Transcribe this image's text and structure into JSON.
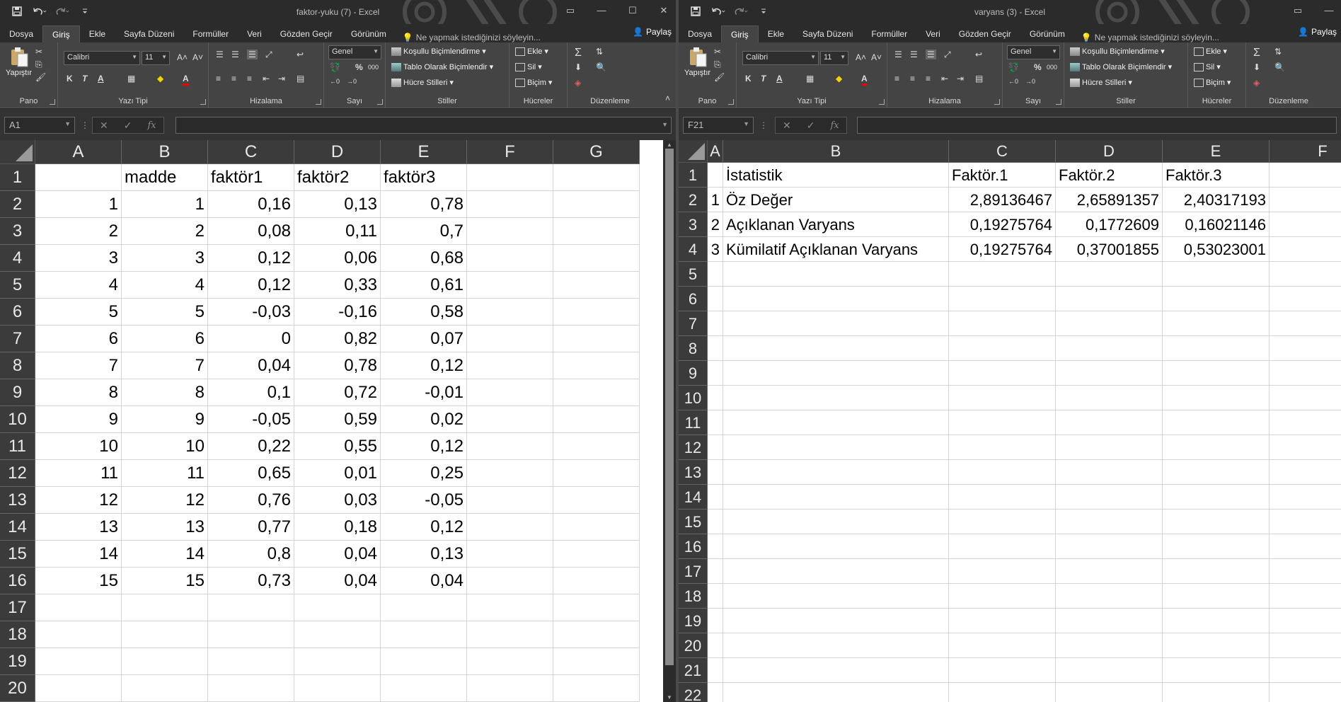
{
  "left": {
    "window_title": "faktor-yuku (7) - Excel",
    "name_box": "A1",
    "columns": [
      "A",
      "B",
      "C",
      "D",
      "E",
      "F",
      "G"
    ],
    "rows": [
      [
        "",
        "madde",
        "faktör1",
        "faktör2",
        "faktör3",
        "",
        ""
      ],
      [
        "1",
        "1",
        "0,16",
        "0,13",
        "0,78",
        "",
        ""
      ],
      [
        "2",
        "2",
        "0,08",
        "0,11",
        "0,7",
        "",
        ""
      ],
      [
        "3",
        "3",
        "0,12",
        "0,06",
        "0,68",
        "",
        ""
      ],
      [
        "4",
        "4",
        "0,12",
        "0,33",
        "0,61",
        "",
        ""
      ],
      [
        "5",
        "5",
        "-0,03",
        "-0,16",
        "0,58",
        "",
        ""
      ],
      [
        "6",
        "6",
        "0",
        "0,82",
        "0,07",
        "",
        ""
      ],
      [
        "7",
        "7",
        "0,04",
        "0,78",
        "0,12",
        "",
        ""
      ],
      [
        "8",
        "8",
        "0,1",
        "0,72",
        "-0,01",
        "",
        ""
      ],
      [
        "9",
        "9",
        "-0,05",
        "0,59",
        "0,02",
        "",
        ""
      ],
      [
        "10",
        "10",
        "0,22",
        "0,55",
        "0,12",
        "",
        ""
      ],
      [
        "11",
        "11",
        "0,65",
        "0,01",
        "0,25",
        "",
        ""
      ],
      [
        "12",
        "12",
        "0,76",
        "0,03",
        "-0,05",
        "",
        ""
      ],
      [
        "13",
        "13",
        "0,77",
        "0,18",
        "0,12",
        "",
        ""
      ],
      [
        "14",
        "14",
        "0,8",
        "0,04",
        "0,13",
        "",
        ""
      ],
      [
        "15",
        "15",
        "0,73",
        "0,04",
        "0,04",
        "",
        ""
      ],
      [
        "",
        "",
        "",
        "",
        "",
        "",
        ""
      ],
      [
        "",
        "",
        "",
        "",
        "",
        "",
        ""
      ],
      [
        "",
        "",
        "",
        "",
        "",
        "",
        ""
      ],
      [
        "",
        "",
        "",
        "",
        "",
        "",
        ""
      ]
    ],
    "row_numbers": [
      "1",
      "2",
      "3",
      "4",
      "5",
      "6",
      "7",
      "8",
      "9",
      "10",
      "11",
      "12",
      "13",
      "14",
      "15",
      "16",
      "17",
      "18",
      "19",
      "20"
    ]
  },
  "right": {
    "window_title": "varyans (3) - Excel",
    "name_box": "F21",
    "columns": [
      "A",
      "B",
      "C",
      "D",
      "E",
      "F"
    ],
    "rows": [
      [
        "",
        "İstatistik",
        "Faktör.1",
        "Faktör.2",
        "Faktör.3",
        ""
      ],
      [
        "1",
        "Öz Değer",
        "2,89136467",
        "2,65891357",
        "2,40317193",
        ""
      ],
      [
        "2",
        "Açıklanan Varyans",
        "0,19275764",
        "0,1772609",
        "0,16021146",
        ""
      ],
      [
        "3",
        "Kümilatif Açıklanan Varyans",
        "0,19275764",
        "0,37001855",
        "0,53023001",
        ""
      ]
    ],
    "row_numbers": [
      "1",
      "2",
      "3",
      "4",
      "5",
      "6",
      "7",
      "8",
      "9",
      "10",
      "11",
      "12",
      "13",
      "14",
      "15",
      "16",
      "17",
      "18",
      "19",
      "20",
      "21",
      "22"
    ]
  },
  "ribbon": {
    "tabs": [
      "Dosya",
      "Giriş",
      "Ekle",
      "Sayfa Düzeni",
      "Formüller",
      "Veri",
      "Gözden Geçir",
      "Görünüm"
    ],
    "tell_me": "Ne yapmak istediğinizi söyleyin...",
    "share": "Paylaş",
    "paste": "Yapıştır",
    "font_name": "Calibri",
    "font_size": "11",
    "bold": "K",
    "italic": "T",
    "underline": "A",
    "font_color_letter": "A",
    "number_format": "Genel",
    "percent": "%",
    "comma": "000",
    "conditional": "Koşullu Biçimlendirme",
    "format_table": "Tablo Olarak Biçimlendir",
    "cell_styles": "Hücre Stilleri",
    "insert": "Ekle",
    "delete": "Sil",
    "format": "Biçim",
    "groups": {
      "clipboard": "Pano",
      "font": "Yazı Tipi",
      "alignment": "Hizalama",
      "number": "Sayı",
      "styles": "Stiller",
      "cells": "Hücreler",
      "editing": "Düzenleme"
    }
  },
  "colors": {
    "ribbon_bg": "#444444",
    "titlebar_bg": "#2b2b2b",
    "header_bg": "#3b3b3b",
    "grid_line": "#d4d4d4"
  }
}
